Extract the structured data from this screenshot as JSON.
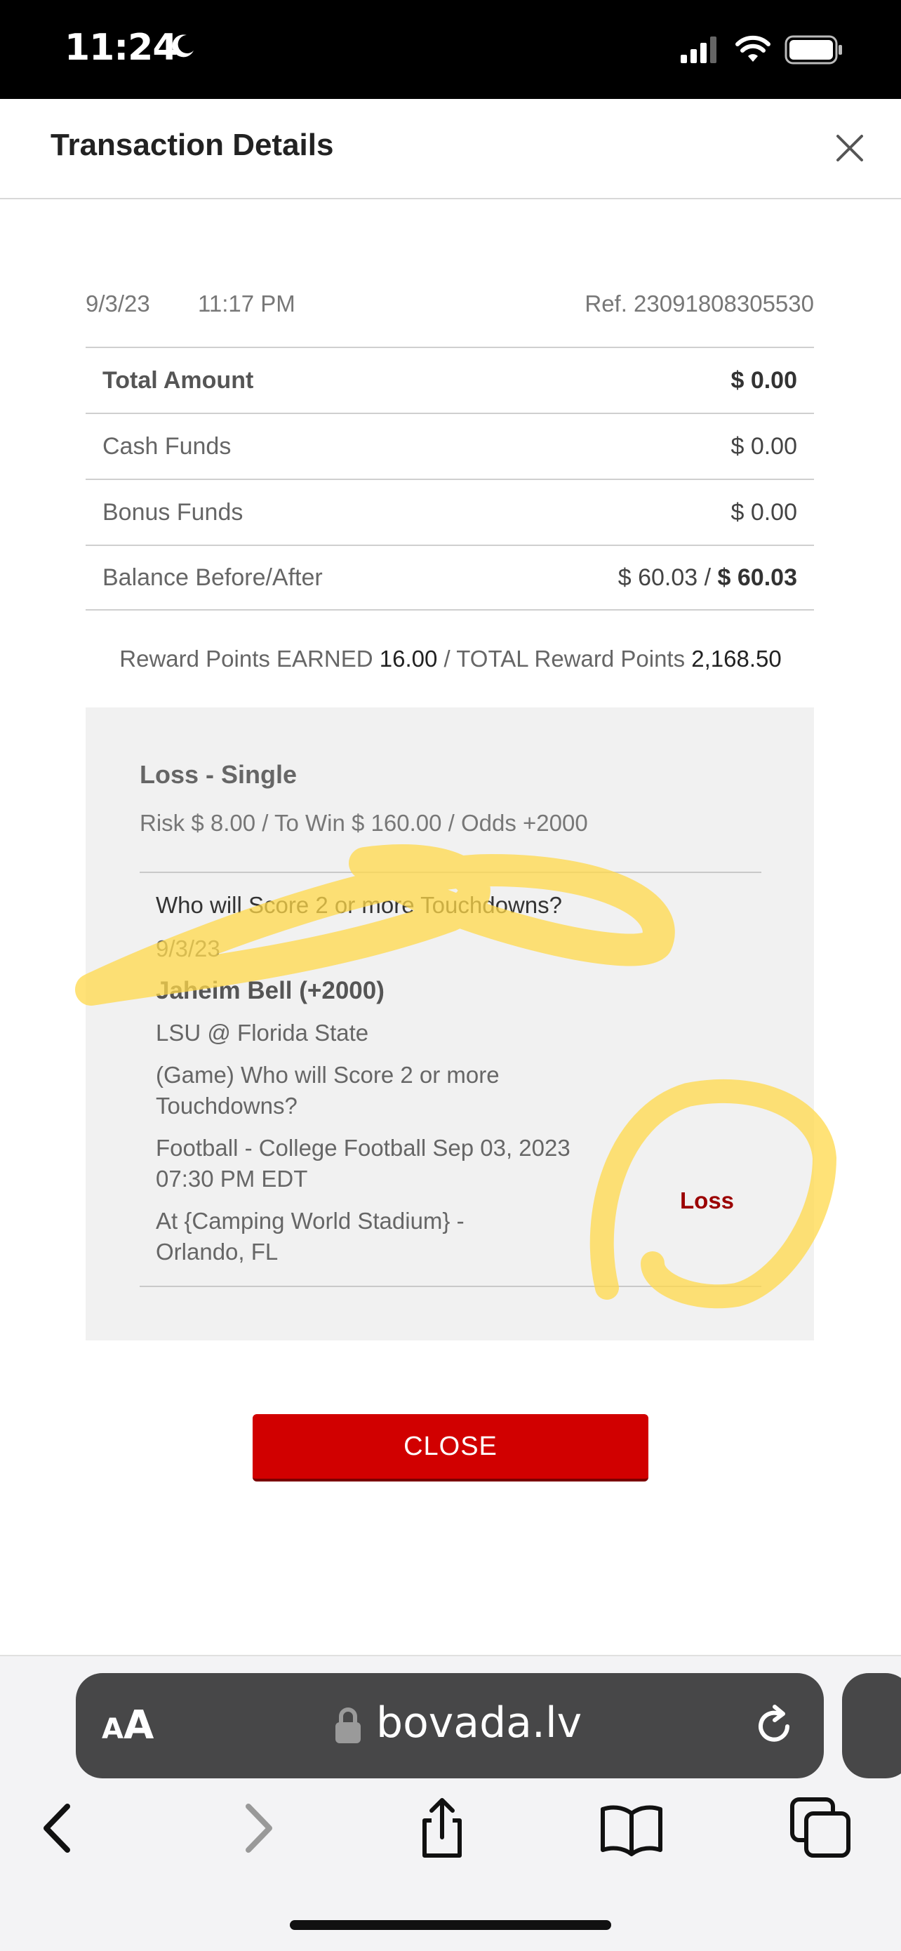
{
  "status_bar": {
    "time": "11:24"
  },
  "header": {
    "title": "Transaction Details"
  },
  "meta": {
    "date": "9/3/23",
    "time": "11:17 PM",
    "ref": "Ref. 23091808305530"
  },
  "summary": {
    "total_label": "Total Amount",
    "total_value": "$ 0.00",
    "cash_label": "Cash Funds",
    "cash_value": "$ 0.00",
    "bonus_label": "Bonus Funds",
    "bonus_value": "$ 0.00",
    "balance_label": "Balance Before/After",
    "balance_before": "$ 60.03 /",
    "balance_after": "$ 60.03"
  },
  "rewards": {
    "earned_label": "Reward Points EARNED",
    "earned_value": "16.00",
    "separator": "/",
    "total_label": "TOTAL Reward Points",
    "total_value": "2,168.50"
  },
  "bet": {
    "title": "Loss - Single",
    "risk_line": "Risk $ 8.00 / To Win $ 160.00 / Odds +2000",
    "question": "Who will Score 2 or more Touchdowns?",
    "date": "9/3/23",
    "pick": "Jaheim Bell (+2000)",
    "matchup": "LSU @ Florida State",
    "game_desc": "(Game) Who will Score 2 or more Touchdowns?",
    "sport": "Football - College Football Sep 03, 2023 07:30 PM EDT",
    "venue": "At {Camping World Stadium} - Orlando, FL",
    "result": "Loss"
  },
  "close_button": "CLOSE",
  "browser": {
    "domain": "bovada.lv",
    "aa_small": "A",
    "aa_big": "A"
  },
  "colors": {
    "accent_red": "#d10000",
    "loss_red": "#9b0000",
    "highlighter": "#ffd84a"
  }
}
